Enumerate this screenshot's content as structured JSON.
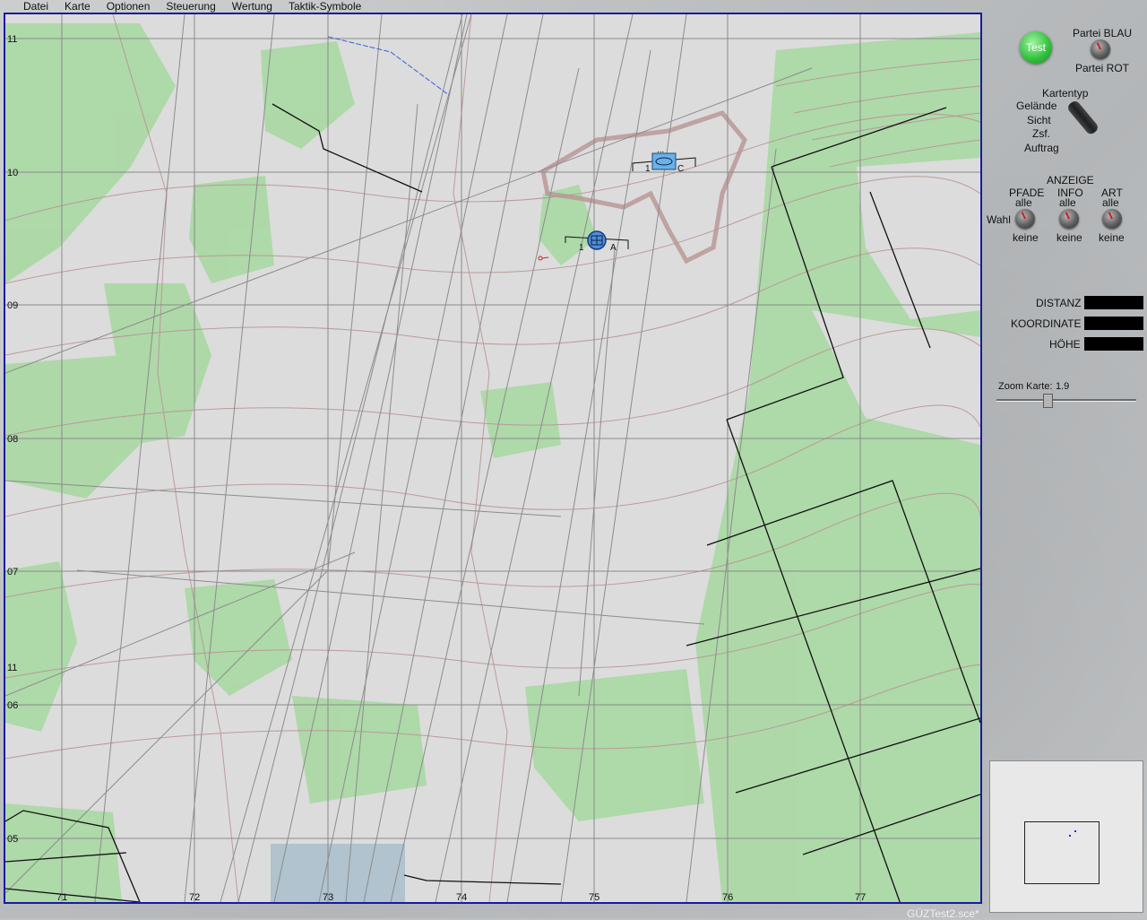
{
  "menu": [
    "Datei",
    "Karte",
    "Optionen",
    "Steuerung",
    "Wertung",
    "Taktik-Symbole"
  ],
  "status_file": "GÜZTest2.sce*",
  "map": {
    "x_labels": [
      "71",
      "72",
      "73",
      "74",
      "75",
      "76",
      "77"
    ],
    "y_labels": [
      "11",
      "10",
      "09",
      "08",
      "07",
      "06",
      "05"
    ],
    "unit_a": {
      "left": "1",
      "right": "A"
    },
    "unit_c": {
      "left": "1",
      "right": "C",
      "top": "..."
    }
  },
  "side": {
    "test": "Test",
    "party_blue": "Partei BLAU",
    "party_red": "Partei ROT",
    "map_type": {
      "title": "Kartentyp",
      "options": [
        "Gelände",
        "Sicht",
        "Zsf.",
        "Auftrag"
      ]
    },
    "display": {
      "title": "ANZEIGE",
      "wahl": "Wahl",
      "cols": [
        {
          "name": "PFADE",
          "top": "alle",
          "bottom": "keine"
        },
        {
          "name": "INFO",
          "top": "alle",
          "bottom": "keine"
        },
        {
          "name": "ART",
          "top": "alle",
          "bottom": "keine"
        }
      ]
    },
    "readouts": {
      "distance": "DISTANZ",
      "coordinate": "KOORDINATE",
      "height": "HÖHE"
    },
    "zoom": {
      "label": "Zoom Karte:",
      "value": "1.9"
    }
  },
  "colors": {
    "map_bg": "#dcdcdc",
    "forest": "#9fd49a",
    "grid": "#7a7a7a",
    "contour": "#b89494",
    "frame": "#1a1aa0",
    "unit": "#6ab2e6"
  }
}
